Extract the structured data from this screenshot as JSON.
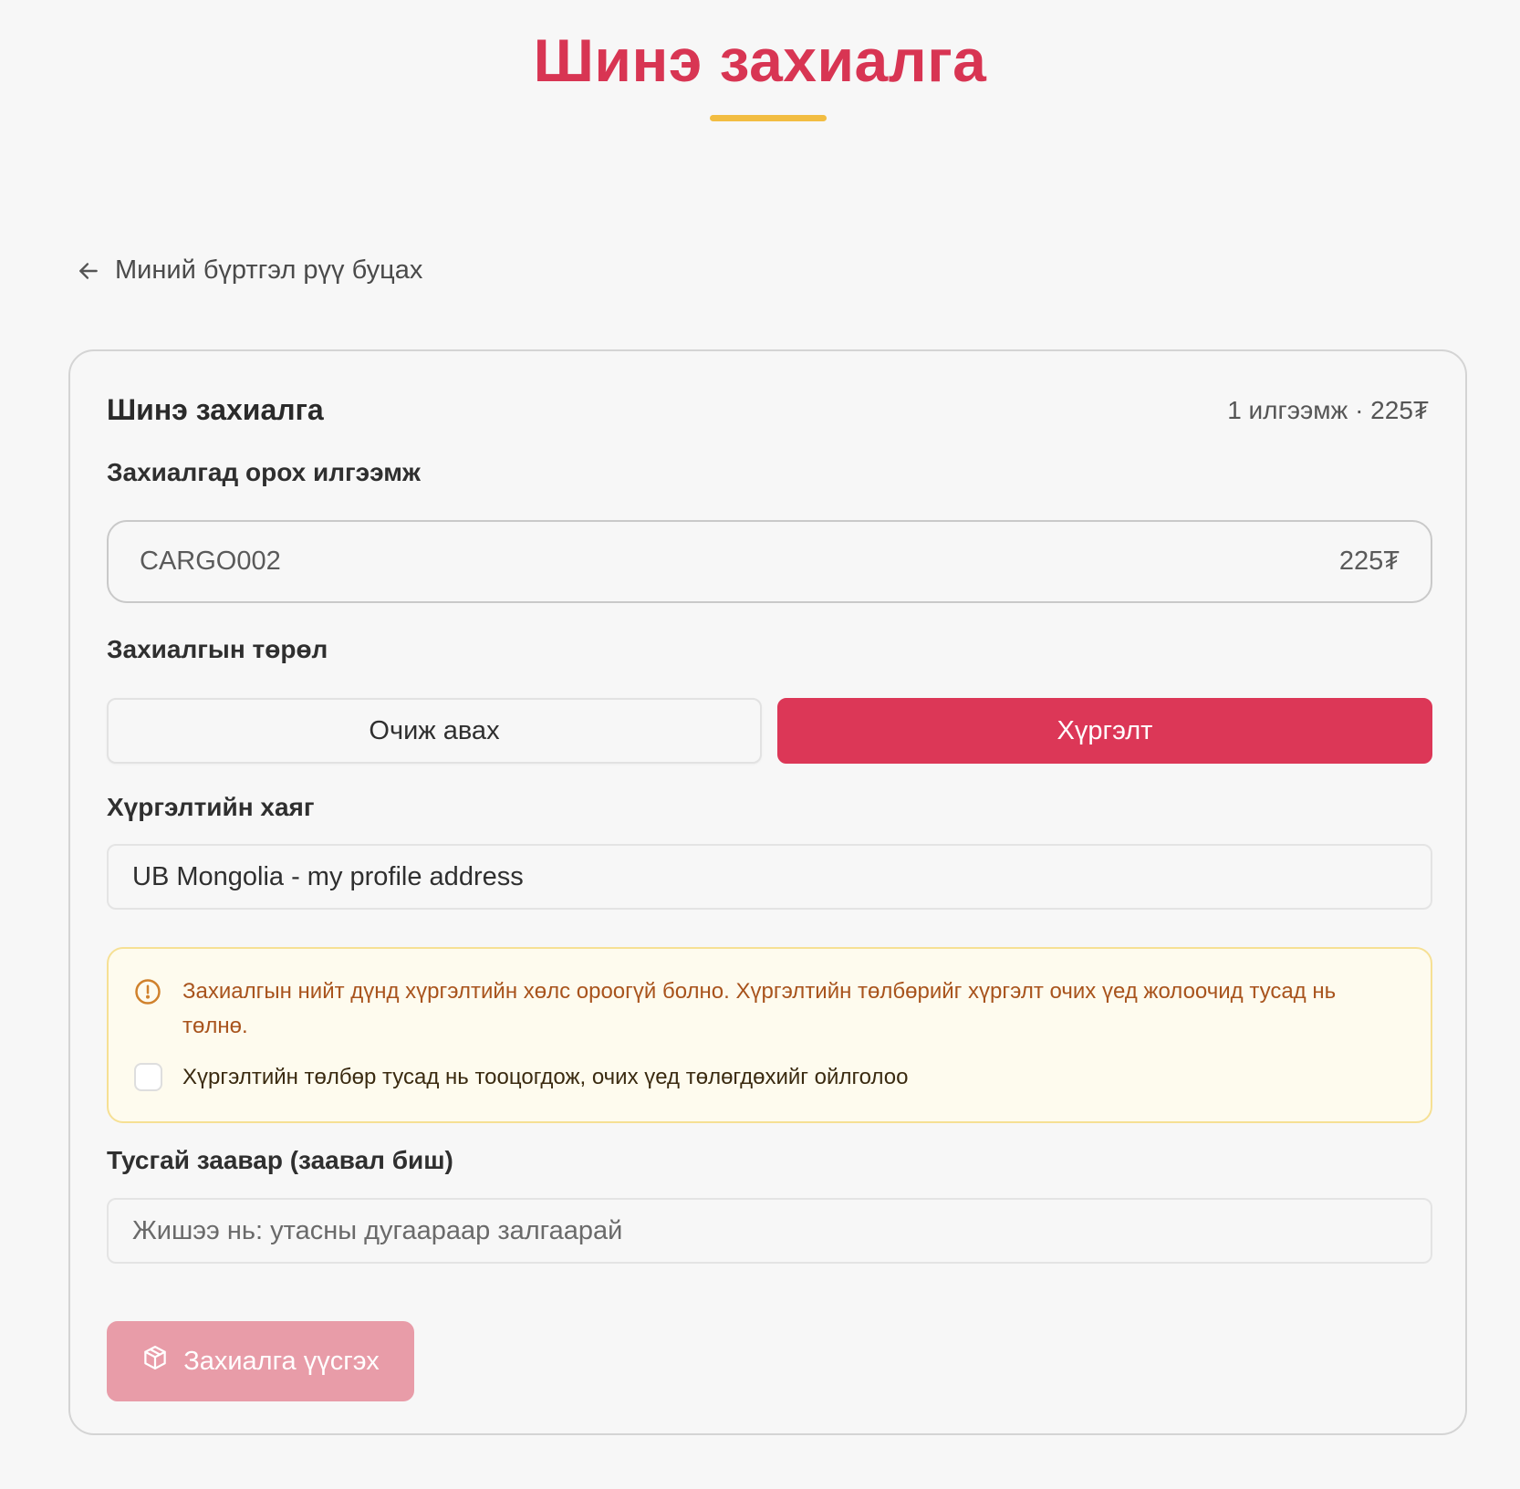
{
  "page": {
    "title": "Шинэ захиалга",
    "back_link": "Миний бүртгэл рүү буцах"
  },
  "card": {
    "title": "Шинэ захиалга",
    "summary": "1 илгээмж · 225₮"
  },
  "shipments": {
    "label": "Захиалгад орох илгээмж",
    "items": [
      {
        "code": "CARGO002",
        "price": "225₮"
      }
    ]
  },
  "order_type": {
    "label": "Захиалгын төрөл",
    "options": [
      {
        "label": "Очиж авах",
        "selected": false
      },
      {
        "label": "Хүргэлт",
        "selected": true
      }
    ]
  },
  "delivery_address": {
    "label": "Хүргэлтийн хаяг",
    "value": "UB Mongolia - my profile address"
  },
  "notice": {
    "icon": "alert-circle-icon",
    "text": "Захиалгын нийт дүнд хүргэлтийн хөлс ороогүй болно. Хүргэлтийн төлбөрийг хүргэлт очих үед жолоочид тусад нь төлнө.",
    "checkbox_label": "Хүргэлтийн төлбөр тусад нь тооцогдож, очих үед төлөгдөхийг ойлголоо",
    "checked": false
  },
  "instructions": {
    "label": "Тусгай заавар (заавал биш)",
    "value": "",
    "placeholder": "Жишээ нь: утасны дугаараар залгаарай"
  },
  "submit": {
    "label": "Захиалга үүсгэх",
    "icon": "package-icon",
    "disabled": true
  },
  "colors": {
    "brand": "#dc3757",
    "accent_underline": "#f2bd42",
    "notice_text": "#a8531c",
    "notice_bg": "#fefbee",
    "submit_disabled": "#e89ca8"
  }
}
